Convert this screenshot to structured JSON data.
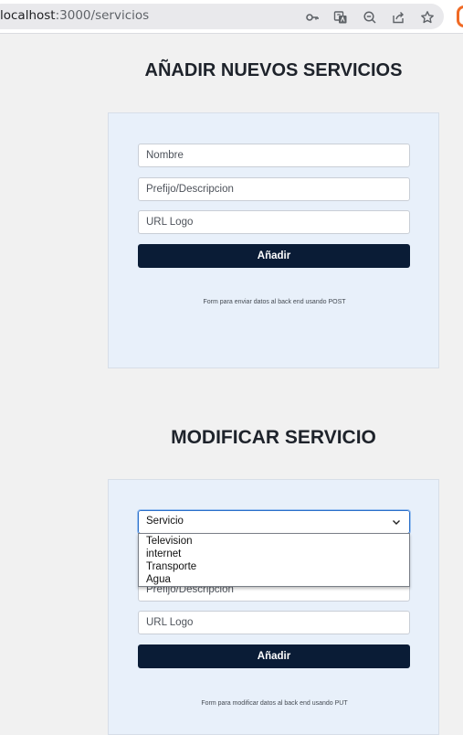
{
  "browser": {
    "url_host": "localhost",
    "url_path": ":3000/servicios",
    "icons": [
      "key-icon",
      "translate-icon",
      "zoom-out-icon",
      "share-icon",
      "star-icon"
    ]
  },
  "add_section": {
    "title": "AÑADIR NUEVOS SERVICIOS",
    "name_placeholder": "Nombre",
    "prefix_placeholder": "Prefijo/Descripcion",
    "logo_placeholder": "URL Logo",
    "button_label": "Añadir",
    "note": "Form para enviar datos al back end usando POST"
  },
  "modify_section": {
    "title": "MODIFICAR SERVICIO",
    "select_value": "Servicio",
    "options": [
      "Television",
      "internet",
      "Transporte",
      "Agua"
    ],
    "prefix_placeholder": "Prefijo/Descripcion",
    "logo_placeholder": "URL Logo",
    "button_label": "Añadir",
    "note": "Form para modificar datos al back end usando PUT"
  },
  "colors": {
    "button_bg": "#0a1c36",
    "card_bg": "#e8f0fa",
    "page_bg": "#f1f1f1",
    "focus_border": "#2b6fc9"
  }
}
